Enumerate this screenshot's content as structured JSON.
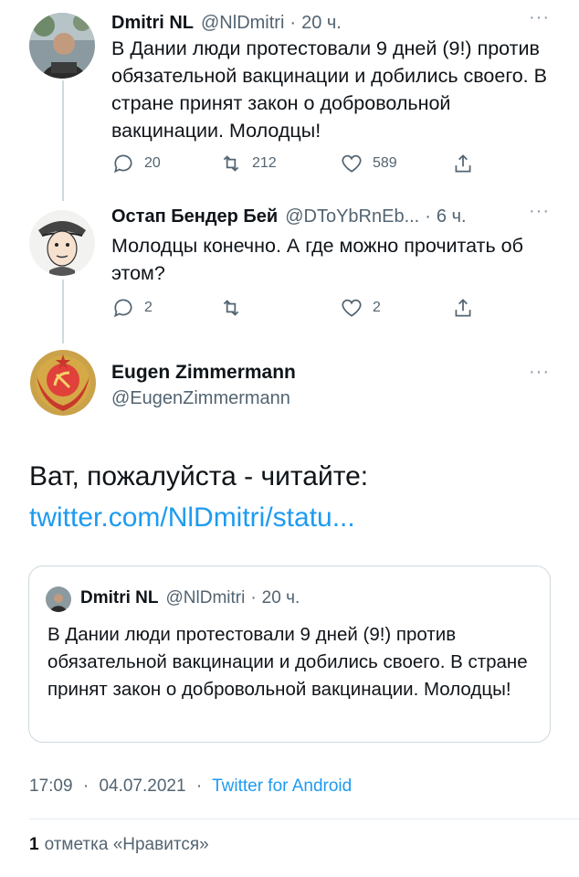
{
  "reply1": {
    "name": "Dmitri NL",
    "handle": "@NlDmitri",
    "time": "20 ч.",
    "more": "···",
    "text": "В Дании люди протестовали 9 дней (9!) против обязательной вакцинации и добились своего. В стране  принят закон о добровольной вакцинации. Молодцы!",
    "replies": "20",
    "retweets": "212",
    "likes": "589"
  },
  "reply2": {
    "name": "Остап Бендер Бей",
    "handle": "@DToYbRnEb...",
    "time": "6 ч.",
    "more": "···",
    "text": "Молодцы конечно. А где можно прочитать об этом?",
    "replies": "2",
    "retweets": "",
    "likes": "2"
  },
  "main": {
    "name": "Eugen Zimmermann",
    "handle": "@EugenZimmermann",
    "more": "···",
    "text": "Ват, пожалуйста - читайте:",
    "link": "twitter.com/NlDmitri/statu..."
  },
  "quote": {
    "name": "Dmitri NL",
    "handle": "@NlDmitri",
    "time": "20 ч.",
    "text": "В Дании люди протестовали 9 дней (9!) против обязательной вакцинации и добились своего. В стране  принят закон о добровольной вакцинации. Молодцы!"
  },
  "meta": {
    "time": "17:09",
    "date": "04.07.2021",
    "source": "Twitter for Android",
    "separator": "·"
  },
  "likes_row": {
    "count": "1",
    "label": "отметка «Нравится»"
  },
  "icons": [
    "reply-icon",
    "retweet-icon",
    "like-icon",
    "share-icon"
  ],
  "colors": {
    "link": "#1d9bf0",
    "secondary": "#536471",
    "border": "#cfd9de"
  }
}
